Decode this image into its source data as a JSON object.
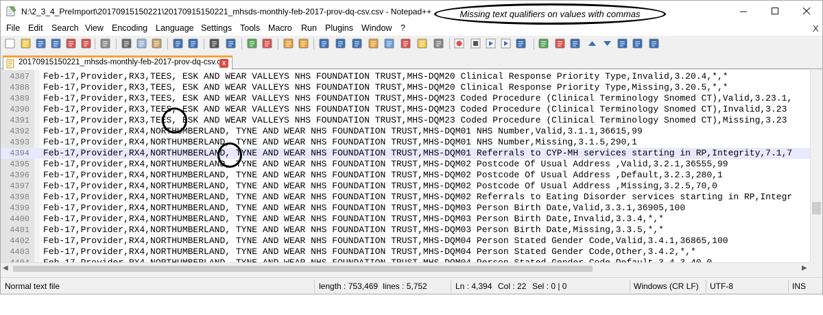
{
  "window": {
    "title": "N:\\2_3_4_PreImport\\20170915150221\\20170915150221_mhsds-monthly-feb-2017-prov-dq-csv.csv - Notepad++"
  },
  "annotation": {
    "text": "Missing text qualifiers on values with commas"
  },
  "menu": {
    "items": [
      "File",
      "Edit",
      "Search",
      "View",
      "Encoding",
      "Language",
      "Settings",
      "Tools",
      "Macro",
      "Run",
      "Plugins",
      "Window",
      "?"
    ],
    "close_glyph": "X"
  },
  "toolbar": {
    "icons": [
      "new-file-icon",
      "open-file-icon",
      "save-icon",
      "save-all-icon",
      "close-icon",
      "close-all-icon",
      "print-icon",
      "cut-icon",
      "copy-icon",
      "paste-icon",
      "undo-icon",
      "redo-icon",
      "find-icon",
      "replace-icon",
      "zoom-in-icon",
      "zoom-out-icon",
      "sync-vertical-icon",
      "sync-horizontal-icon",
      "word-wrap-icon",
      "show-all-chars-icon",
      "indent-guide-icon",
      "user-lang-icon",
      "doc-map-icon",
      "function-list-icon",
      "folder-workspace-icon",
      "monitoring-icon",
      "record-macro-icon",
      "stop-record-icon",
      "play-macro-icon",
      "play-multiple-icon",
      "save-macro-icon",
      "spellcheck-icon",
      "compare-icon",
      "compare-options-icon",
      "compare-prev-icon",
      "compare-next-icon",
      "compare-first-icon",
      "compare-last-icon",
      "compare-nav-icon"
    ]
  },
  "tab": {
    "label": "20170915150221_mhsds-monthly-feb-2017-prov-dq-csv.csv",
    "close": "x"
  },
  "editor": {
    "current_line": 4394,
    "lines": [
      {
        "num": "4387",
        "text": "Feb-17,Provider,RX3,TEES, ESK AND WEAR VALLEYS NHS FOUNDATION TRUST,MHS-DQM20 Clinical Response Priority Type,Invalid,3.20.4,*,*"
      },
      {
        "num": "4388",
        "text": "Feb-17,Provider,RX3,TEES, ESK AND WEAR VALLEYS NHS FOUNDATION TRUST,MHS-DQM20 Clinical Response Priority Type,Missing,3.20.5,*,*"
      },
      {
        "num": "4389",
        "text": "Feb-17,Provider,RX3,TEES, ESK AND WEAR VALLEYS NHS FOUNDATION TRUST,MHS-DQM23 Coded Procedure (Clinical Terminology Snomed CT),Valid,3.23.1,"
      },
      {
        "num": "4390",
        "text": "Feb-17,Provider,RX3,TEES, ESK AND WEAR VALLEYS NHS FOUNDATION TRUST,MHS-DQM23 Coded Procedure (Clinical Terminology Snomed CT),Invalid,3.23"
      },
      {
        "num": "4391",
        "text": "Feb-17,Provider,RX3,TEES, ESK AND WEAR VALLEYS NHS FOUNDATION TRUST,MHS-DQM23 Coded Procedure (Clinical Terminology Snomed CT),Missing,3.23"
      },
      {
        "num": "4392",
        "text": "Feb-17,Provider,RX4,NORTHUMBERLAND, TYNE AND WEAR NHS FOUNDATION TRUST,MHS-DQM01 NHS Number,Valid,3.1.1,36615,99"
      },
      {
        "num": "4393",
        "text": "Feb-17,Provider,RX4,NORTHUMBERLAND, TYNE AND WEAR NHS FOUNDATION TRUST,MHS-DQM01 NHS Number,Missing,3.1.5,290,1"
      },
      {
        "num": "4394",
        "text": "Feb-17,Provider,RX4,NORTHUMBERLAND, TYNE AND WEAR NHS FOUNDATION TRUST,MHS-DQM01 Referrals to CYP-MH services starting in RP,Integrity,7.1,7"
      },
      {
        "num": "4395",
        "text": "Feb-17,Provider,RX4,NORTHUMBERLAND, TYNE AND WEAR NHS FOUNDATION TRUST,MHS-DQM02 Postcode Of Usual Address ,Valid,3.2.1,36555,99"
      },
      {
        "num": "4396",
        "text": "Feb-17,Provider,RX4,NORTHUMBERLAND, TYNE AND WEAR NHS FOUNDATION TRUST,MHS-DQM02 Postcode Of Usual Address ,Default,3.2.3,280,1"
      },
      {
        "num": "4397",
        "text": "Feb-17,Provider,RX4,NORTHUMBERLAND, TYNE AND WEAR NHS FOUNDATION TRUST,MHS-DQM02 Postcode Of Usual Address ,Missing,3.2.5,70,0"
      },
      {
        "num": "4398",
        "text": "Feb-17,Provider,RX4,NORTHUMBERLAND, TYNE AND WEAR NHS FOUNDATION TRUST,MHS-DQM02 Referrals to Eating Disorder services starting in RP,Integr"
      },
      {
        "num": "4399",
        "text": "Feb-17,Provider,RX4,NORTHUMBERLAND, TYNE AND WEAR NHS FOUNDATION TRUST,MHS-DQM03 Person Birth Date,Valid,3.3.1,36905,100"
      },
      {
        "num": "4400",
        "text": "Feb-17,Provider,RX4,NORTHUMBERLAND, TYNE AND WEAR NHS FOUNDATION TRUST,MHS-DQM03 Person Birth Date,Invalid,3.3.4,*,*"
      },
      {
        "num": "4401",
        "text": "Feb-17,Provider,RX4,NORTHUMBERLAND, TYNE AND WEAR NHS FOUNDATION TRUST,MHS-DQM03 Person Birth Date,Missing,3.3.5,*,*"
      },
      {
        "num": "4402",
        "text": "Feb-17,Provider,RX4,NORTHUMBERLAND, TYNE AND WEAR NHS FOUNDATION TRUST,MHS-DQM04 Person Stated Gender Code,Valid,3.4.1,36865,100"
      },
      {
        "num": "4403",
        "text": "Feb-17,Provider,RX4,NORTHUMBERLAND, TYNE AND WEAR NHS FOUNDATION TRUST,MHS-DQM04 Person Stated Gender Code,Other,3.4.2,*,*"
      },
      {
        "num": "4404",
        "text": "Feb-17,Provider,RX4,NORTHUMBERLAND, TYNE AND WEAR NHS FOUNDATION TRUST,MHS-DQM04 Person Stated Gender Code,Default,3.4.3,40,0"
      }
    ]
  },
  "status": {
    "file_type": "Normal text file",
    "length": "length : 753,469",
    "lines": "lines : 5,752",
    "ln": "Ln : 4,394",
    "col": "Col : 22",
    "sel": "Sel : 0 | 0",
    "eol": "Windows (CR LF)",
    "encoding": "UTF-8",
    "mode": "INS"
  },
  "colors": {
    "current_line": "#e8e8ff",
    "tab_accent": "#f7a23b",
    "gutter": "#e4e4e4"
  }
}
